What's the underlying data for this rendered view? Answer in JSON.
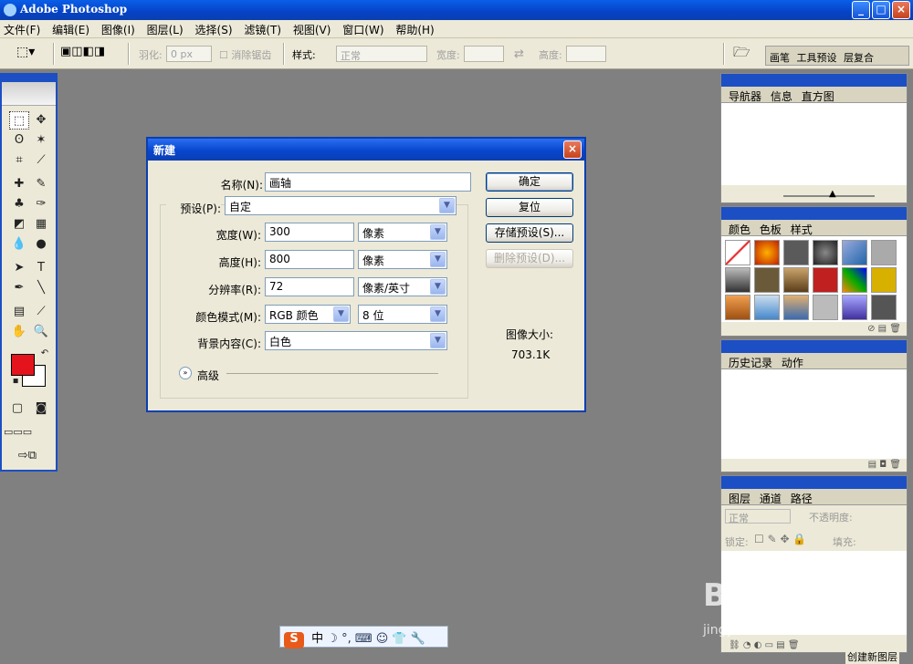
{
  "app": {
    "title": "Adobe Photoshop"
  },
  "menu": [
    "文件(F)",
    "编辑(E)",
    "图像(I)",
    "图层(L)",
    "选择(S)",
    "滤镜(T)",
    "视图(V)",
    "窗口(W)",
    "帮助(H)"
  ],
  "options": {
    "feather_label": "羽化:",
    "feather_value": "0 px",
    "antialias_label": "消除锯齿",
    "style_label": "样式:",
    "style_value": "正常",
    "width_label": "宽度:",
    "height_label": "高度:"
  },
  "palette_well": [
    "画笔",
    "工具预设",
    "层复合"
  ],
  "dialog": {
    "title": "新建",
    "name_label": "名称(N):",
    "name_value": "画轴",
    "preset_label": "预设(P):",
    "preset_value": "自定",
    "width_label": "宽度(W):",
    "width_value": "300",
    "width_unit": "像素",
    "height_label": "高度(H):",
    "height_value": "800",
    "height_unit": "像素",
    "resolution_label": "分辨率(R):",
    "resolution_value": "72",
    "resolution_unit": "像素/英寸",
    "color_mode_label": "颜色模式(M):",
    "color_mode_value": "RGB 颜色",
    "bit_depth_value": "8 位",
    "bg_label": "背景内容(C):",
    "bg_value": "白色",
    "advanced_label": "高级",
    "ok_label": "确定",
    "reset_label": "复位",
    "save_preset_label": "存储预设(S)...",
    "delete_preset_label": "删除预设(D)...",
    "image_size_label": "图像大小:",
    "image_size_value": "703.1K"
  },
  "panels": {
    "navigator_tabs": [
      "导航器",
      "信息",
      "直方图"
    ],
    "color_tabs": [
      "颜色",
      "色板",
      "样式"
    ],
    "history_tabs": [
      "历史记录",
      "动作"
    ],
    "layers_tabs": [
      "图层",
      "通道",
      "路径"
    ],
    "layers_mode": "正常",
    "opacity_label": "不透明度:",
    "lock_label": "锁定:",
    "fill_label": "填充:",
    "status_text": "创建新图层"
  },
  "ime": {
    "logo": "S",
    "lang": "中"
  },
  "watermark": {
    "text": "Baidu经验",
    "url": "jingyan.baidu.com"
  },
  "colors": {
    "foreground": "#e5141c",
    "background": "#ffffff",
    "title_blue": "#0a3fb0"
  }
}
